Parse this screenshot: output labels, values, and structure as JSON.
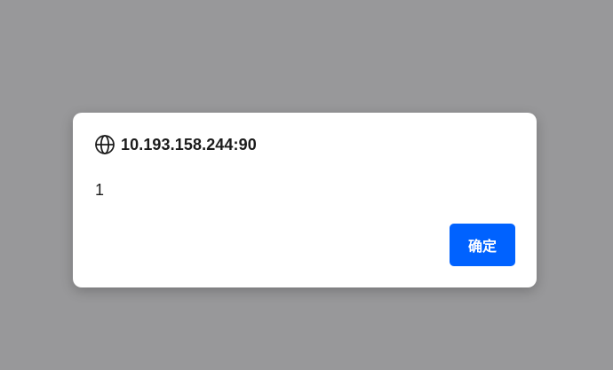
{
  "dialog": {
    "origin": "10.193.158.244:90",
    "origin_icon": "globe-icon",
    "message": "1",
    "ok_label": "确定"
  },
  "colors": {
    "overlay": "#98989a",
    "dialog_bg": "#ffffff",
    "button_bg": "#0062ff",
    "button_text": "#ffffff",
    "text": "#1b1b1b"
  }
}
